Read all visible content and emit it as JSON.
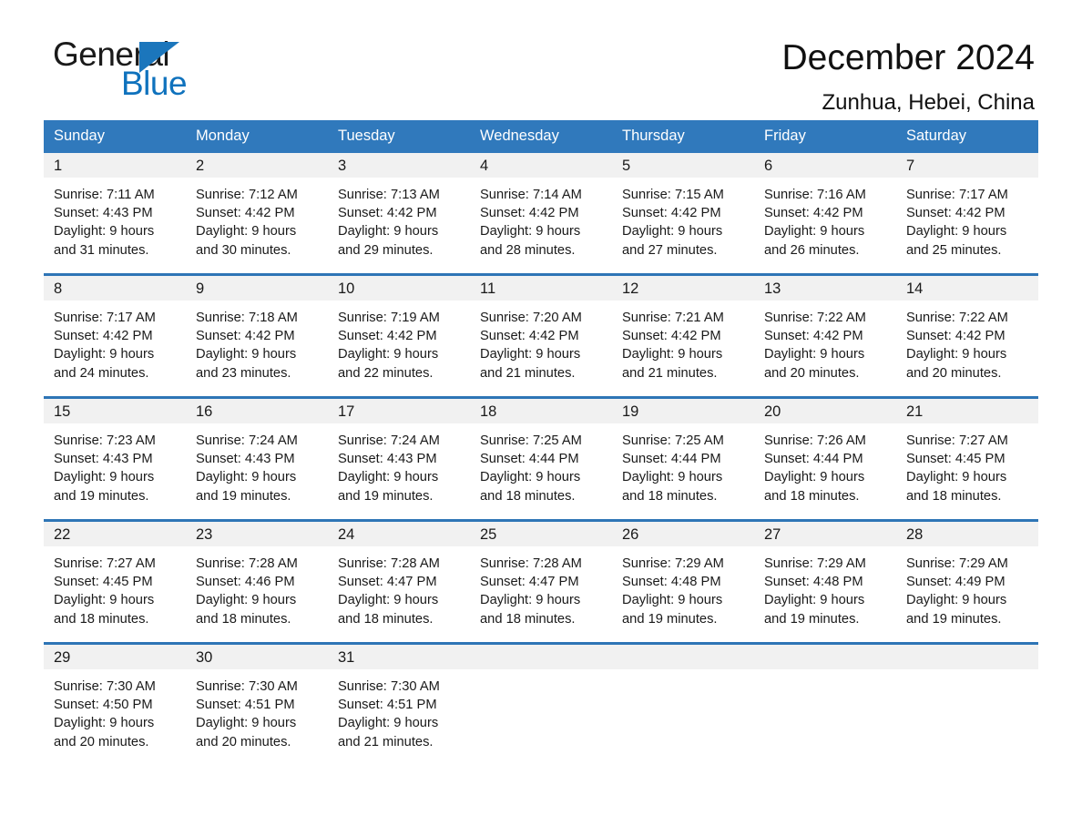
{
  "brand": {
    "name_part1": "General",
    "name_part2": "Blue",
    "triangle_icon": "brand-triangle-icon",
    "blue": "#1b76bc"
  },
  "header": {
    "title": "December 2024",
    "location": "Zunhua, Hebei, China"
  },
  "theme": {
    "header_blue": "#3079bc",
    "rule_blue": "#2e75b6",
    "daynum_band": "#f1f1f1",
    "text": "#1a1a1a"
  },
  "weekdays": [
    "Sunday",
    "Monday",
    "Tuesday",
    "Wednesday",
    "Thursday",
    "Friday",
    "Saturday"
  ],
  "weeks": [
    [
      {
        "day": "1",
        "sunrise": "Sunrise: 7:11 AM",
        "sunset": "Sunset: 4:43 PM",
        "daylight_line1": "Daylight: 9 hours",
        "daylight_line2": "and 31 minutes."
      },
      {
        "day": "2",
        "sunrise": "Sunrise: 7:12 AM",
        "sunset": "Sunset: 4:42 PM",
        "daylight_line1": "Daylight: 9 hours",
        "daylight_line2": "and 30 minutes."
      },
      {
        "day": "3",
        "sunrise": "Sunrise: 7:13 AM",
        "sunset": "Sunset: 4:42 PM",
        "daylight_line1": "Daylight: 9 hours",
        "daylight_line2": "and 29 minutes."
      },
      {
        "day": "4",
        "sunrise": "Sunrise: 7:14 AM",
        "sunset": "Sunset: 4:42 PM",
        "daylight_line1": "Daylight: 9 hours",
        "daylight_line2": "and 28 minutes."
      },
      {
        "day": "5",
        "sunrise": "Sunrise: 7:15 AM",
        "sunset": "Sunset: 4:42 PM",
        "daylight_line1": "Daylight: 9 hours",
        "daylight_line2": "and 27 minutes."
      },
      {
        "day": "6",
        "sunrise": "Sunrise: 7:16 AM",
        "sunset": "Sunset: 4:42 PM",
        "daylight_line1": "Daylight: 9 hours",
        "daylight_line2": "and 26 minutes."
      },
      {
        "day": "7",
        "sunrise": "Sunrise: 7:17 AM",
        "sunset": "Sunset: 4:42 PM",
        "daylight_line1": "Daylight: 9 hours",
        "daylight_line2": "and 25 minutes."
      }
    ],
    [
      {
        "day": "8",
        "sunrise": "Sunrise: 7:17 AM",
        "sunset": "Sunset: 4:42 PM",
        "daylight_line1": "Daylight: 9 hours",
        "daylight_line2": "and 24 minutes."
      },
      {
        "day": "9",
        "sunrise": "Sunrise: 7:18 AM",
        "sunset": "Sunset: 4:42 PM",
        "daylight_line1": "Daylight: 9 hours",
        "daylight_line2": "and 23 minutes."
      },
      {
        "day": "10",
        "sunrise": "Sunrise: 7:19 AM",
        "sunset": "Sunset: 4:42 PM",
        "daylight_line1": "Daylight: 9 hours",
        "daylight_line2": "and 22 minutes."
      },
      {
        "day": "11",
        "sunrise": "Sunrise: 7:20 AM",
        "sunset": "Sunset: 4:42 PM",
        "daylight_line1": "Daylight: 9 hours",
        "daylight_line2": "and 21 minutes."
      },
      {
        "day": "12",
        "sunrise": "Sunrise: 7:21 AM",
        "sunset": "Sunset: 4:42 PM",
        "daylight_line1": "Daylight: 9 hours",
        "daylight_line2": "and 21 minutes."
      },
      {
        "day": "13",
        "sunrise": "Sunrise: 7:22 AM",
        "sunset": "Sunset: 4:42 PM",
        "daylight_line1": "Daylight: 9 hours",
        "daylight_line2": "and 20 minutes."
      },
      {
        "day": "14",
        "sunrise": "Sunrise: 7:22 AM",
        "sunset": "Sunset: 4:42 PM",
        "daylight_line1": "Daylight: 9 hours",
        "daylight_line2": "and 20 minutes."
      }
    ],
    [
      {
        "day": "15",
        "sunrise": "Sunrise: 7:23 AM",
        "sunset": "Sunset: 4:43 PM",
        "daylight_line1": "Daylight: 9 hours",
        "daylight_line2": "and 19 minutes."
      },
      {
        "day": "16",
        "sunrise": "Sunrise: 7:24 AM",
        "sunset": "Sunset: 4:43 PM",
        "daylight_line1": "Daylight: 9 hours",
        "daylight_line2": "and 19 minutes."
      },
      {
        "day": "17",
        "sunrise": "Sunrise: 7:24 AM",
        "sunset": "Sunset: 4:43 PM",
        "daylight_line1": "Daylight: 9 hours",
        "daylight_line2": "and 19 minutes."
      },
      {
        "day": "18",
        "sunrise": "Sunrise: 7:25 AM",
        "sunset": "Sunset: 4:44 PM",
        "daylight_line1": "Daylight: 9 hours",
        "daylight_line2": "and 18 minutes."
      },
      {
        "day": "19",
        "sunrise": "Sunrise: 7:25 AM",
        "sunset": "Sunset: 4:44 PM",
        "daylight_line1": "Daylight: 9 hours",
        "daylight_line2": "and 18 minutes."
      },
      {
        "day": "20",
        "sunrise": "Sunrise: 7:26 AM",
        "sunset": "Sunset: 4:44 PM",
        "daylight_line1": "Daylight: 9 hours",
        "daylight_line2": "and 18 minutes."
      },
      {
        "day": "21",
        "sunrise": "Sunrise: 7:27 AM",
        "sunset": "Sunset: 4:45 PM",
        "daylight_line1": "Daylight: 9 hours",
        "daylight_line2": "and 18 minutes."
      }
    ],
    [
      {
        "day": "22",
        "sunrise": "Sunrise: 7:27 AM",
        "sunset": "Sunset: 4:45 PM",
        "daylight_line1": "Daylight: 9 hours",
        "daylight_line2": "and 18 minutes."
      },
      {
        "day": "23",
        "sunrise": "Sunrise: 7:28 AM",
        "sunset": "Sunset: 4:46 PM",
        "daylight_line1": "Daylight: 9 hours",
        "daylight_line2": "and 18 minutes."
      },
      {
        "day": "24",
        "sunrise": "Sunrise: 7:28 AM",
        "sunset": "Sunset: 4:47 PM",
        "daylight_line1": "Daylight: 9 hours",
        "daylight_line2": "and 18 minutes."
      },
      {
        "day": "25",
        "sunrise": "Sunrise: 7:28 AM",
        "sunset": "Sunset: 4:47 PM",
        "daylight_line1": "Daylight: 9 hours",
        "daylight_line2": "and 18 minutes."
      },
      {
        "day": "26",
        "sunrise": "Sunrise: 7:29 AM",
        "sunset": "Sunset: 4:48 PM",
        "daylight_line1": "Daylight: 9 hours",
        "daylight_line2": "and 19 minutes."
      },
      {
        "day": "27",
        "sunrise": "Sunrise: 7:29 AM",
        "sunset": "Sunset: 4:48 PM",
        "daylight_line1": "Daylight: 9 hours",
        "daylight_line2": "and 19 minutes."
      },
      {
        "day": "28",
        "sunrise": "Sunrise: 7:29 AM",
        "sunset": "Sunset: 4:49 PM",
        "daylight_line1": "Daylight: 9 hours",
        "daylight_line2": "and 19 minutes."
      }
    ],
    [
      {
        "day": "29",
        "sunrise": "Sunrise: 7:30 AM",
        "sunset": "Sunset: 4:50 PM",
        "daylight_line1": "Daylight: 9 hours",
        "daylight_line2": "and 20 minutes."
      },
      {
        "day": "30",
        "sunrise": "Sunrise: 7:30 AM",
        "sunset": "Sunset: 4:51 PM",
        "daylight_line1": "Daylight: 9 hours",
        "daylight_line2": "and 20 minutes."
      },
      {
        "day": "31",
        "sunrise": "Sunrise: 7:30 AM",
        "sunset": "Sunset: 4:51 PM",
        "daylight_line1": "Daylight: 9 hours",
        "daylight_line2": "and 21 minutes."
      },
      {
        "day": "",
        "sunrise": "",
        "sunset": "",
        "daylight_line1": "",
        "daylight_line2": ""
      },
      {
        "day": "",
        "sunrise": "",
        "sunset": "",
        "daylight_line1": "",
        "daylight_line2": ""
      },
      {
        "day": "",
        "sunrise": "",
        "sunset": "",
        "daylight_line1": "",
        "daylight_line2": ""
      },
      {
        "day": "",
        "sunrise": "",
        "sunset": "",
        "daylight_line1": "",
        "daylight_line2": ""
      }
    ]
  ]
}
